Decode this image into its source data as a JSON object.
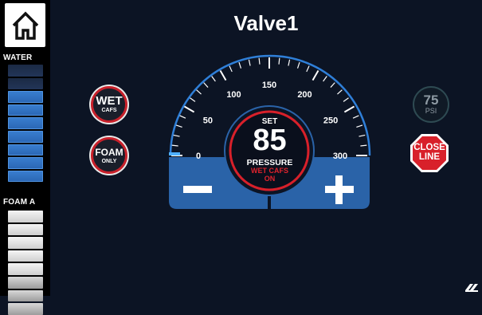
{
  "title": "Valve1",
  "sidebar": {
    "water_label": "WATER",
    "water_level_filled_segments": 7,
    "water_total_segments": 9,
    "foam_label": "FOAM A",
    "foam_level_filled_segments": 8,
    "foam_total_segments": 8
  },
  "buttons": {
    "wet_main": "WET",
    "wet_sub": "CAFS",
    "foam_main": "FOAM",
    "foam_sub": "ONLY",
    "psi_value": "75",
    "psi_unit": "PSI",
    "close_line_1": "CLOSE",
    "close_line_2": "LINE"
  },
  "gauge": {
    "min": 0,
    "max": 300,
    "tick_labels": [
      "0",
      "50",
      "100",
      "150",
      "200",
      "250",
      "300"
    ],
    "set_label": "SET",
    "set_value": "85",
    "pressure_label": "PRESSURE",
    "mode_line1": "WET CAFS",
    "mode_line2": "ON",
    "pressure_bar_value": 4
  },
  "colors": {
    "accent_blue": "#2f7fd8",
    "panel_blue": "#2a63a8",
    "alert_red": "#d8202a",
    "background": "#0c1424"
  },
  "icons": {
    "home": "home-icon",
    "minus": "minus-icon",
    "plus": "plus-icon",
    "stop": "stop-sign-icon"
  }
}
